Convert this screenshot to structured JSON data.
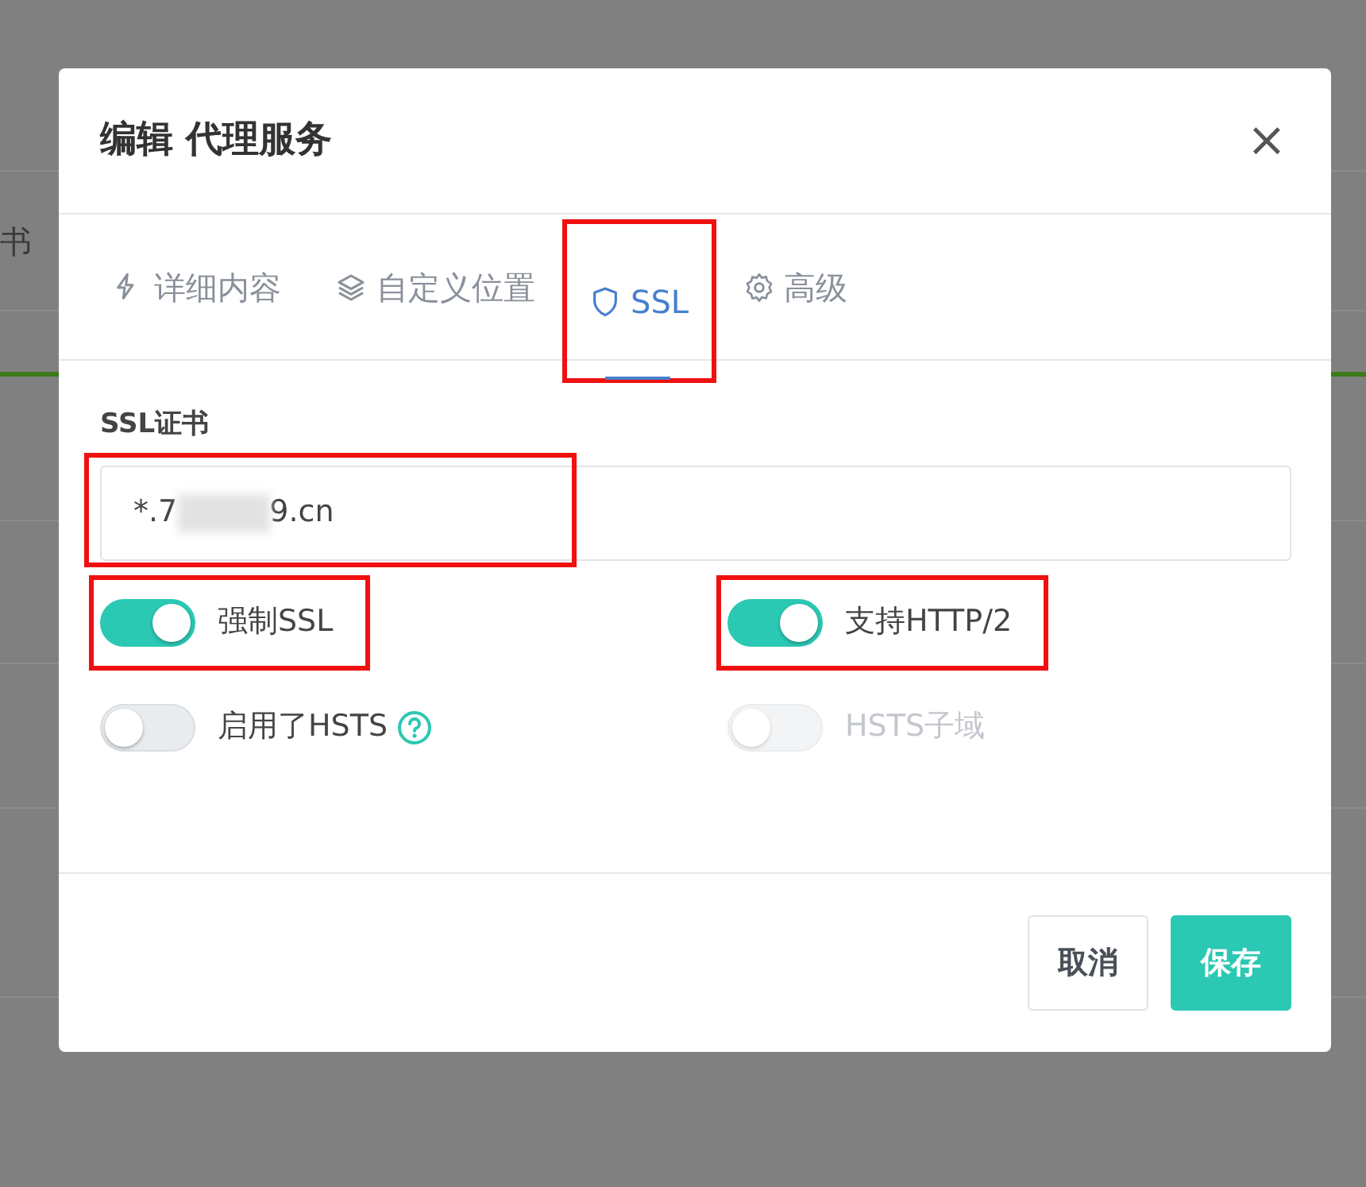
{
  "background": {
    "text": "书"
  },
  "dialog": {
    "title": "编辑 代理服务",
    "close": "×"
  },
  "tabs": [
    {
      "label": "详细内容",
      "selected": false,
      "annotated": false
    },
    {
      "label": "自定义位置",
      "selected": false,
      "annotated": false
    },
    {
      "label": "SSL",
      "selected": true,
      "annotated": true
    },
    {
      "label": "高级",
      "selected": false,
      "annotated": false
    }
  ],
  "certificate": {
    "label": "SSL证书",
    "value_start": "*.7",
    "redacted": true,
    "value_end": "9.cn",
    "annotated": true
  },
  "switches": [
    {
      "label": "强制SSL",
      "on": true,
      "disabled": false,
      "help": false,
      "annotated": true
    },
    {
      "label": "支持HTTP/2",
      "on": true,
      "disabled": false,
      "help": false,
      "annotated": true
    },
    {
      "label": "启用了HSTS",
      "on": false,
      "disabled": false,
      "help": true,
      "annotated": false
    },
    {
      "label": "HSTS子域",
      "on": false,
      "disabled": true,
      "help": false,
      "annotated": false
    }
  ],
  "buttons": [
    {
      "label": "取消",
      "kind": "secondary"
    },
    {
      "label": "保存",
      "kind": "primary"
    }
  ]
}
